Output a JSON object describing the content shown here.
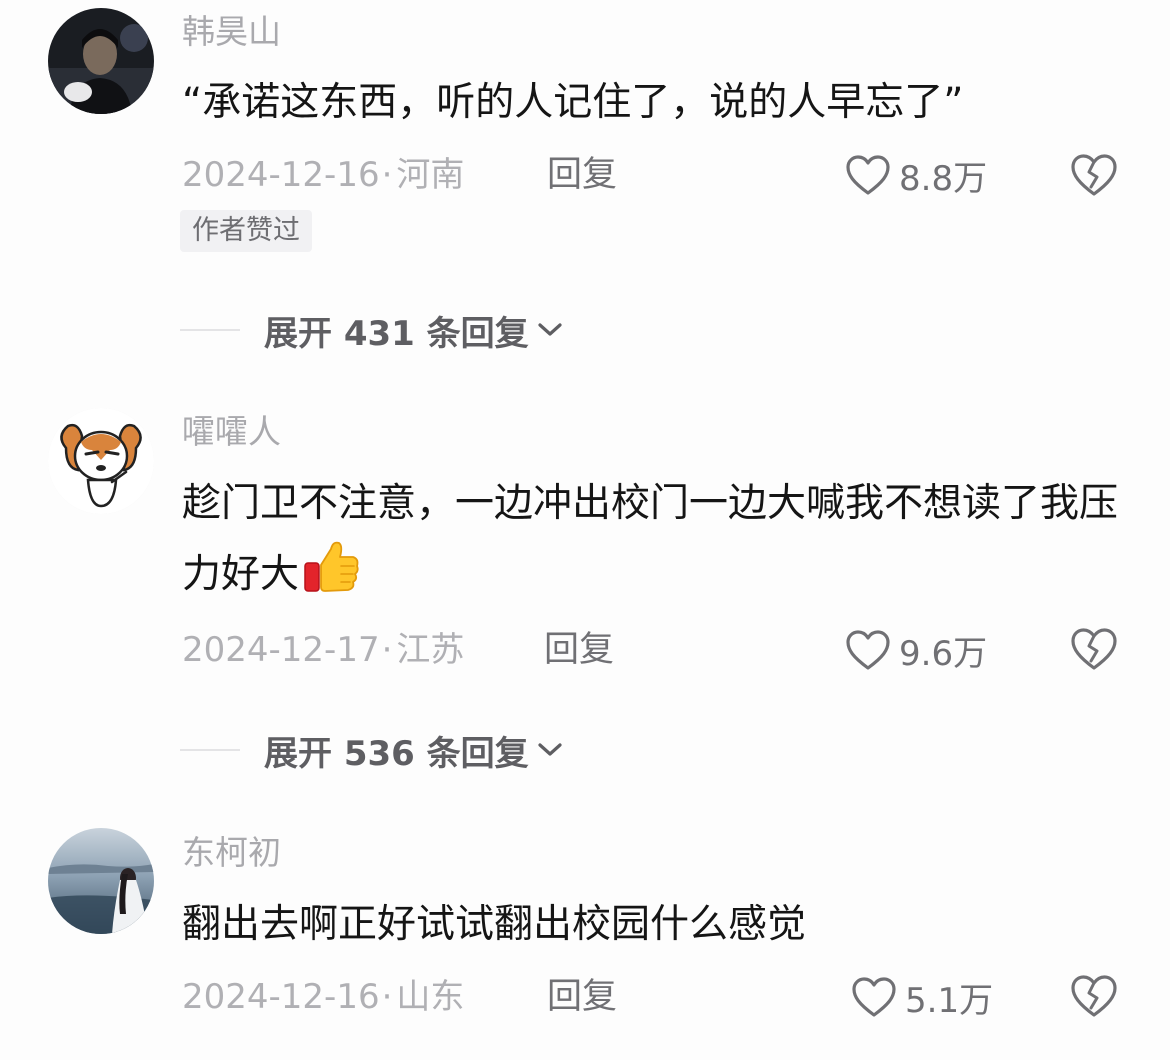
{
  "comments": [
    {
      "username": "韩昊山",
      "content": "“承诺这东西，听的人记住了，说的人早忘了”",
      "date": "2024-12-16",
      "location": "河南",
      "reply_label": "回复",
      "likes": "8.8万",
      "badge": "作者赞过",
      "expand_label": "展开 431 条回复"
    },
    {
      "username": "嚯嚯人",
      "content": "趁门卫不注意，一边冲出校门一边大喊我不想读了我压力好大",
      "date": "2024-12-17",
      "location": "江苏",
      "reply_label": "回复",
      "likes": "9.6万",
      "expand_label": "展开 536 条回复"
    },
    {
      "username": "东柯初",
      "content": "翻出去啊正好试试翻出校园什么感觉",
      "date": "2024-12-16",
      "location": "山东",
      "reply_label": "回复",
      "likes": "5.1万"
    }
  ],
  "icons": {
    "like": "heart-outline-icon",
    "dislike": "broken-heart-icon",
    "expand": "chevron-down-icon",
    "emoji": "thumbs-up-emoji"
  },
  "colors": {
    "username": "#a9a9ad",
    "content": "#151515",
    "meta": "#b0b0b4",
    "action": "#707074"
  }
}
